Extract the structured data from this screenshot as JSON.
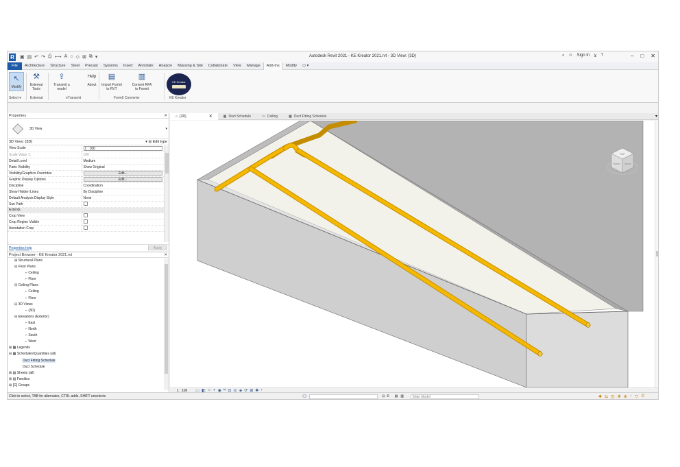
{
  "titlebar": {
    "app_icon": "R",
    "title": "Autodesk Revit 2021 - KE Kreator 2021.rvt - 3D View: {3D}",
    "sign_in": "Sign In",
    "help": "?"
  },
  "ribbon_tabs": [
    "File",
    "Architecture",
    "Structure",
    "Steel",
    "Precast",
    "Systems",
    "Insert",
    "Annotate",
    "Analyze",
    "Massing & Site",
    "Collaborate",
    "View",
    "Manage",
    "Add-Ins",
    "Modify"
  ],
  "ribbon": {
    "buttons": [
      {
        "label": "Modify",
        "icon": "cursor-arrow-icon"
      },
      {
        "label": "External Tools",
        "icon": "tools-icon"
      },
      {
        "label": "Transmit a model",
        "icon": "transmit-icon"
      },
      {
        "label": "About",
        "icon": "help-icon"
      },
      {
        "label": "Import Formit to RVT",
        "icon": "import-icon"
      },
      {
        "label": "Convert RFA to Formit",
        "icon": "convert-icon"
      }
    ],
    "help_label": "Help",
    "groups": [
      "Select ▾",
      "External",
      "eTransmit",
      "FormIt Converter",
      "KE Kreator"
    ],
    "kf_logo_text": "KE Kreator"
  },
  "properties": {
    "title": "Properties",
    "type_name": "3D View",
    "instance_label": "3D View: {3D}",
    "edit_type": "Edit type",
    "rows": [
      {
        "k": "View Scale",
        "v": "1 : 100",
        "kind": "box"
      },
      {
        "k": "Scale Value   1:",
        "v": "100",
        "kind": "gray"
      },
      {
        "k": "Detail Level",
        "v": "Medium",
        "kind": "text"
      },
      {
        "k": "Parts Visibility",
        "v": "Show Original",
        "kind": "text"
      },
      {
        "k": "Visibility/Graphics Overrides",
        "v": "Edit...",
        "kind": "btn"
      },
      {
        "k": "Graphic Display Options",
        "v": "Edit...",
        "kind": "btn"
      },
      {
        "k": "Discipline",
        "v": "Coordination",
        "kind": "text"
      },
      {
        "k": "Show Hidden Lines",
        "v": "By Discipline",
        "kind": "text"
      },
      {
        "k": "Default Analysis Display Style",
        "v": "None",
        "kind": "text"
      },
      {
        "k": "Sun Path",
        "v": "",
        "kind": "chk"
      }
    ],
    "section": "Extents",
    "rows2": [
      {
        "k": "Crop View",
        "v": "",
        "kind": "chk"
      },
      {
        "k": "Crop Region Visible",
        "v": "",
        "kind": "chk"
      },
      {
        "k": "Annotation Crop",
        "v": "",
        "kind": "chk"
      }
    ],
    "help_link": "Properties help",
    "apply": "Apply"
  },
  "browser": {
    "title": "Project Browser - KE Kreator 2021.rvt",
    "items": [
      {
        "t": "Structural Plans",
        "indent": 10,
        "prefix": "⊞ "
      },
      {
        "t": "Floor Plans",
        "indent": 10,
        "prefix": "⊟ "
      },
      {
        "t": "Ceiling",
        "indent": 26,
        "prefix": "⌐ "
      },
      {
        "t": "Floor",
        "indent": 26,
        "prefix": "⌐ "
      },
      {
        "t": "Ceiling Plans",
        "indent": 10,
        "prefix": "⊟ "
      },
      {
        "t": "Ceiling",
        "indent": 26,
        "prefix": "⌐ "
      },
      {
        "t": "Floor",
        "indent": 26,
        "prefix": "⌐ "
      },
      {
        "t": "3D Views",
        "indent": 10,
        "prefix": "⊟ "
      },
      {
        "t": "{3D}",
        "indent": 26,
        "prefix": "⌐ "
      },
      {
        "t": "Elevations (Exterior)",
        "indent": 10,
        "prefix": "⊟ "
      },
      {
        "t": "East",
        "indent": 26,
        "prefix": "⌐ "
      },
      {
        "t": "North",
        "indent": 26,
        "prefix": "⌐ "
      },
      {
        "t": "South",
        "indent": 26,
        "prefix": "⌐ "
      },
      {
        "t": "West",
        "indent": 26,
        "prefix": "⌐ "
      },
      {
        "t": "Legends",
        "indent": 2,
        "prefix": "⊞ ▦ "
      },
      {
        "t": "Schedules/Quantities (all)",
        "indent": 2,
        "prefix": "⊟ ▦ "
      },
      {
        "t": "Duct Fitting Schedule",
        "indent": 22,
        "prefix": "",
        "selected": true
      },
      {
        "t": "Duct Schedule",
        "indent": 22,
        "prefix": ""
      },
      {
        "t": "Sheets (all)",
        "indent": 2,
        "prefix": "⊞ ▤ "
      },
      {
        "t": "Families",
        "indent": 2,
        "prefix": "⊞ ▥ "
      },
      {
        "t": "Groups",
        "indent": 2,
        "prefix": "⊞ [G] "
      }
    ]
  },
  "view_tabs": [
    {
      "label": "{3D}",
      "active": true
    },
    {
      "label": "Duct Schedule",
      "active": false
    },
    {
      "label": "Ceiling",
      "active": false
    },
    {
      "label": "Duct Fitting Schedule",
      "active": false
    }
  ],
  "viewcube": {
    "top": "TOP",
    "front": "FRONT",
    "right": "RIGHT"
  },
  "view_bar": {
    "scale": "1 : 100"
  },
  "status": {
    "text": "Click to select, TAB for alternates, CTRL adds, SHIFT unselects.",
    "zero": ":0",
    "model": "Main Model"
  },
  "colors": {
    "pipe": "#f5b800",
    "pipe_dark": "#c48c00",
    "wall_light": "#e8e8e8",
    "wall_mid": "#cfcfcf",
    "wall_dark": "#a8a8a8",
    "floor": "#f2f1ea",
    "accent": "#1f5aa8"
  }
}
